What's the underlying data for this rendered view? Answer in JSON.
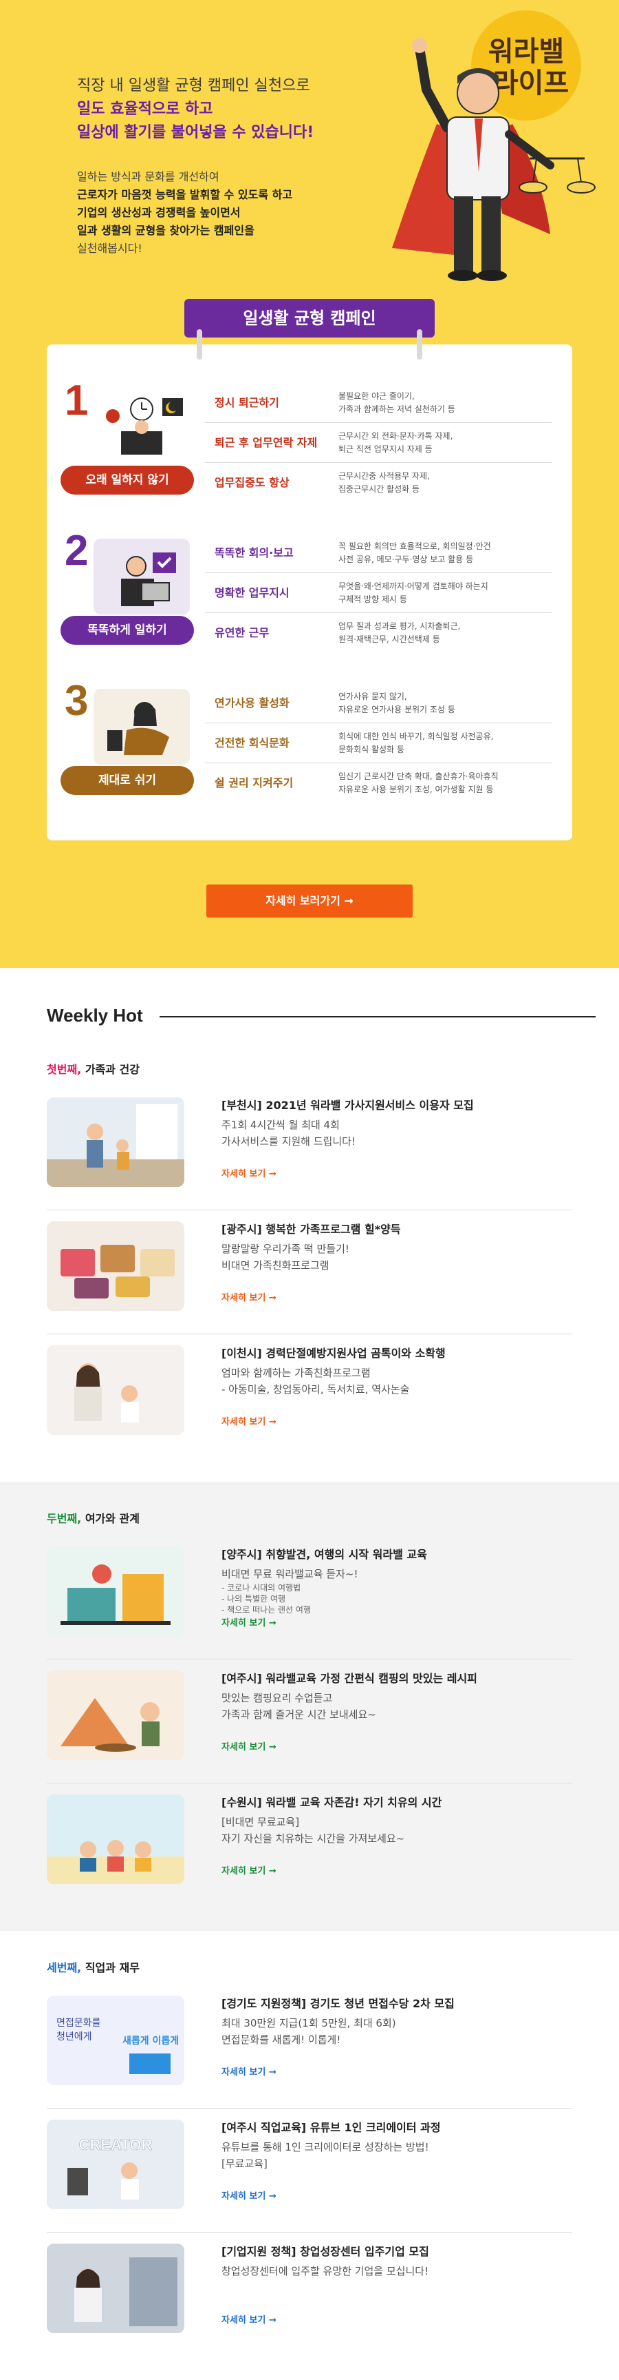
{
  "hero": {
    "line1": "직장 내 일생활 균형 캠페인 실천으로",
    "line2": "일도 효율적으로 하고",
    "line3": "일상에 활기를 불어넣을 수 있습니다!",
    "desc1": "일하는 방식과 문화를 개선하여",
    "desc2": "근로자가 마음껏 능력을 발휘할 수 있도록 하고",
    "desc3": "기업의 생산성과 경쟁력을 높이면서",
    "desc4": "일과 생활의 균형을 찾아가는 캠페인을",
    "desc5": "실천해봅시다!",
    "badge_line1": "워라밸",
    "badge_line2": "라이프"
  },
  "campaign": {
    "title": "일생활 균형 캠페인",
    "sections": [
      {
        "num": "1",
        "label": "오래 일하지 않기",
        "rows": [
          {
            "title": "정시 퇴근하기",
            "desc": "불필요한 야근 줄이기,\n가족과 함께하는 저녁 실천하기 등"
          },
          {
            "title": "퇴근 후 업무연락 자제",
            "desc": "근무시간 외 전화·문자·카톡 자제,\n퇴근 직전 업무지시 자제 등"
          },
          {
            "title": "업무집중도 향상",
            "desc": "근무시간중 사적용무 자제,\n집중근무시간 활성화 등"
          }
        ]
      },
      {
        "num": "2",
        "label": "똑똑하게 일하기",
        "rows": [
          {
            "title": "똑똑한 회의·보고",
            "desc": "꼭 필요한 회의만 효율적으로, 회의일정·안건\n사전 공유, 메모·구두·영상 보고 활용 등"
          },
          {
            "title": "명확한 업무지시",
            "desc": "무엇을·왜·언제까지·어떻게 검토해야 하는지\n구체적 방향 제시 등"
          },
          {
            "title": "유연한 근무",
            "desc": "업무 질과 성과로 평가, 시차출퇴근,\n원격·재택근무, 시간선택제 등"
          }
        ]
      },
      {
        "num": "3",
        "label": "제대로 쉬기",
        "rows": [
          {
            "title": "연가사용 활성화",
            "desc": "연가사유 묻지 않기,\n자유로운 연가사용 분위기 조성 등"
          },
          {
            "title": "건전한 회식문화",
            "desc": "회식에 대한 인식 바꾸기, 회식일정 사전공유,\n문화회식 활성화 등"
          },
          {
            "title": "쉴 권리 지켜주기",
            "desc": "임신기 근로시간 단축 확대, 출산휴가·육아휴직\n자유로운 사용 분위기 조성, 여가생활 지원 등"
          }
        ]
      }
    ],
    "more_button": "자세히 보러가기 →"
  },
  "weekly": {
    "title": "Weekly Hot",
    "blocks": [
      {
        "tag": "첫번째,",
        "title": " 가족과 건강",
        "items": [
          {
            "title": "[부천시] 2021년 워라밸 가사지원서비스 이용자 모집",
            "sub1": "주1회 4시간씩 월 최대 4회",
            "sub2": "가사서비스를 지원해 드립니다!",
            "link": "자세히 보기 →"
          },
          {
            "title": "[광주시] 행복한 가족프로그램 힐*양득",
            "sub1": "말랑말랑 우리가족 떡 만들기!",
            "sub2": "비대면 가족친화프로그램",
            "link": "자세히 보기 →"
          },
          {
            "title": "[이천시] 경력단절예방지원사업 곰톡이와 소확행",
            "sub1": "엄마와 함께하는 가족친화프로그램",
            "sub2": "- 아동미술, 창업동아리, 독서치료, 역사논술",
            "link": "자세히 보기 →"
          }
        ]
      },
      {
        "tag": "두번째,",
        "title": " 여가와 관계",
        "items": [
          {
            "title": "[양주시] 취향발견, 여행의 시작 워라밸 교육",
            "sub1": "비대면 무료 워라밸교육 듣자~!",
            "small1": "- 코로나 시대의 여행법",
            "small2": "- 나의 특별한 여행",
            "small3": "- 책으로 떠나는 랜선 여행",
            "link": "자세히 보기 →"
          },
          {
            "title": "[여주시] 워라밸교육 가정 간편식 캠핑의 맛있는 레시피",
            "sub1": "맛있는 캠핑요리 수업듣고",
            "sub2": "가족과 함께 즐거운 시간 보내세요~",
            "link": "자세히 보기 →"
          },
          {
            "title": "[수원시] 워라밸 교육 자존감! 자기 치유의 시간",
            "sub1": "[비대면 무료교육]",
            "sub2": "자기 자신을 치유하는 시간을 가져보세요~",
            "link": "자세히 보기 →"
          }
        ]
      },
      {
        "tag": "세번째,",
        "title": " 직업과 재무",
        "items": [
          {
            "title": "[경기도 지원정책] 경기도 청년 면접수당 2차 모집",
            "sub1": "최대 30만원 지급(1회 5만원, 최대 6회)",
            "sub2": "면접문화를 새롭게! 이롭게!",
            "link": "자세히 보기 →",
            "thumb_text1": "면접문화를",
            "thumb_text2": "청년에게",
            "thumb_text3": "새롭게 이롭게"
          },
          {
            "title": "[여주시 직업교육] 유튜브 1인 크리에이터 과정",
            "sub1": "유튜브를 통해 1인 크리에이터로 성장하는 방법!",
            "sub2": "[무료교육]",
            "link": "자세히 보기 →",
            "thumb_text1": "CREATOR"
          },
          {
            "title": "[기업지원 정책] 창업성장센터 입주기업 모집",
            "sub1": "창업성장센터에 입주할 유망한 기업을 모십니다!",
            "link": "자세히 보기 →"
          }
        ]
      }
    ]
  }
}
